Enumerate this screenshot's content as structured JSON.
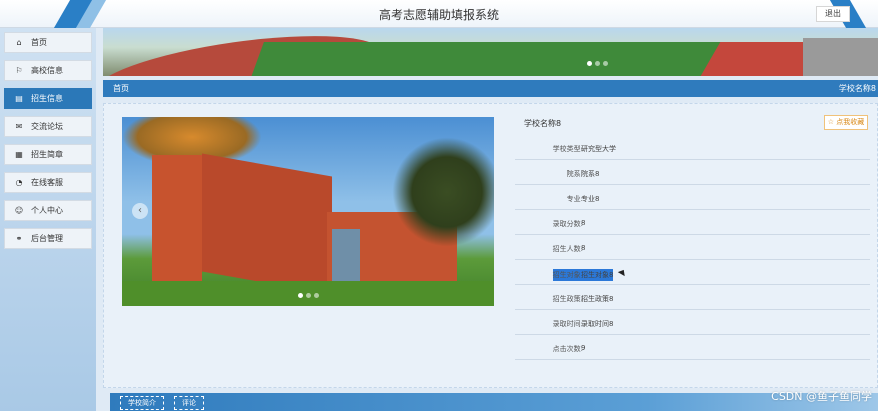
{
  "header": {
    "title": "高考志愿辅助填报系统",
    "logout_label": "退出"
  },
  "sidebar": {
    "items": [
      {
        "label": "首页",
        "icon": "home-icon",
        "glyph": "⌂"
      },
      {
        "label": "高校信息",
        "icon": "flag-icon",
        "glyph": "⚐"
      },
      {
        "label": "招生信息",
        "icon": "list-icon",
        "glyph": "▤",
        "active": true
      },
      {
        "label": "交流论坛",
        "icon": "chat-icon",
        "glyph": "✉"
      },
      {
        "label": "招生简章",
        "icon": "grid-icon",
        "glyph": "▦"
      },
      {
        "label": "在线客服",
        "icon": "headset-icon",
        "glyph": "◔"
      },
      {
        "label": "个人中心",
        "icon": "user-icon",
        "glyph": "☺"
      },
      {
        "label": "后台管理",
        "icon": "link-icon",
        "glyph": "⚭"
      }
    ]
  },
  "breadcrumb": {
    "home": "首页",
    "current": "学校名称8"
  },
  "detail": {
    "school_name": "学校名称8",
    "favorite_label": "☆ 点我收藏",
    "fields": [
      {
        "label": "学校类型:",
        "value": "研究型大学"
      },
      {
        "label": "院系:",
        "value": "院系8"
      },
      {
        "label": "专业:",
        "value": "专业8"
      },
      {
        "label": "录取分数:",
        "value": "8"
      },
      {
        "label": "招生人数:",
        "value": "8"
      },
      {
        "label": "招生对象:",
        "value": "招生对象8"
      },
      {
        "label": "招生政策:",
        "value": "招生政策8"
      },
      {
        "label": "录取时间:",
        "value": "录取时间8"
      },
      {
        "label": "点击次数:",
        "value": "9"
      }
    ]
  },
  "tabs": [
    {
      "label": "学校简介"
    },
    {
      "label": "评论"
    }
  ],
  "watermark": "CSDN @鱼子鱼同学",
  "colors": {
    "primary": "#2f7bbd",
    "active_nav": "#2b78b8",
    "favorite": "#d88a1a"
  }
}
